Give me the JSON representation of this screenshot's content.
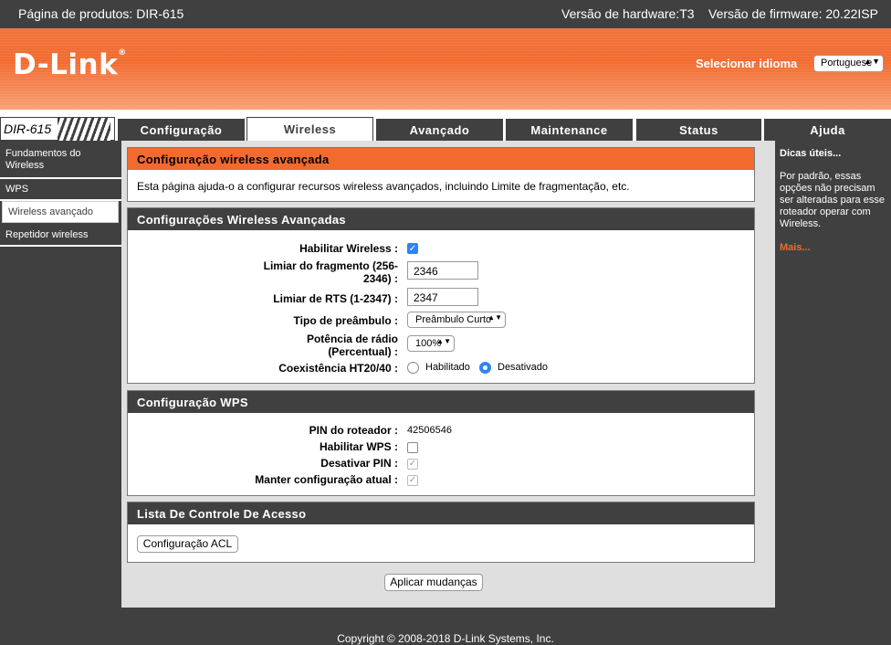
{
  "topbar": {
    "product": "Página de produtos: DIR-615",
    "hardware": "Versão de hardware:T3",
    "firmware": "Versão de firmware: 20.22ISP"
  },
  "header": {
    "logo": "D-Link",
    "language_label": "Selecionar idioma",
    "language_value": "Portuguese"
  },
  "nav": {
    "model": "DIR-615",
    "tabs": [
      "Configuração",
      "Wireless",
      "Avançado",
      "Maintenance",
      "Status",
      "Ajuda"
    ],
    "active_tab": "Wireless"
  },
  "sidebar": {
    "items": [
      "Fundamentos do Wireless",
      "WPS",
      "Wireless avançado",
      "Repetidor wireless"
    ],
    "active": "Wireless avançado"
  },
  "intro": {
    "title": "Configuração wireless avançada",
    "text": "Esta página ajuda-o a configurar recursos wireless avançados, incluindo Limite de fragmentação, etc."
  },
  "advanced": {
    "title": "Configurações Wireless Avançadas",
    "enable_wireless_label": "Habilitar Wireless :",
    "enable_wireless": true,
    "frag_label": "Limiar do fragmento (256-2346) :",
    "frag_value": "2346",
    "rts_label": "Limiar de RTS (1-2347) :",
    "rts_value": "2347",
    "preamble_label": "Tipo de preâmbulo :",
    "preamble_value": "Preâmbulo Curto",
    "power_label": "Potência de rádio (Percentual) :",
    "power_value": "100%",
    "coex_label": "Coexistência HT20/40 :",
    "coex_enabled_label": "Habilitado",
    "coex_disabled_label": "Desativado",
    "coex_value": "Desativado"
  },
  "wps": {
    "title": "Configuração WPS",
    "pin_label": "PIN do roteador :",
    "pin_value": "42506546",
    "enable_label": "Habilitar WPS :",
    "enable": false,
    "disable_pin_label": "Desativar PIN :",
    "keep_config_label": "Manter configuração atual :"
  },
  "acl": {
    "title": "Lista De Controle De Acesso",
    "button": "Configuração ACL"
  },
  "apply_button": "Aplicar mudanças",
  "hints": {
    "title": "Dicas úteis...",
    "body": "Por padrão, essas opções não precisam ser alteradas para esse roteador operar com Wireless.",
    "more": "Mais..."
  },
  "footer": {
    "copyright": "Copyright © 2008-2018 D-Link Systems, Inc."
  },
  "colors": {
    "accent": "#f26a2e",
    "dark": "#404040",
    "check_blue": "#2f84f5"
  }
}
